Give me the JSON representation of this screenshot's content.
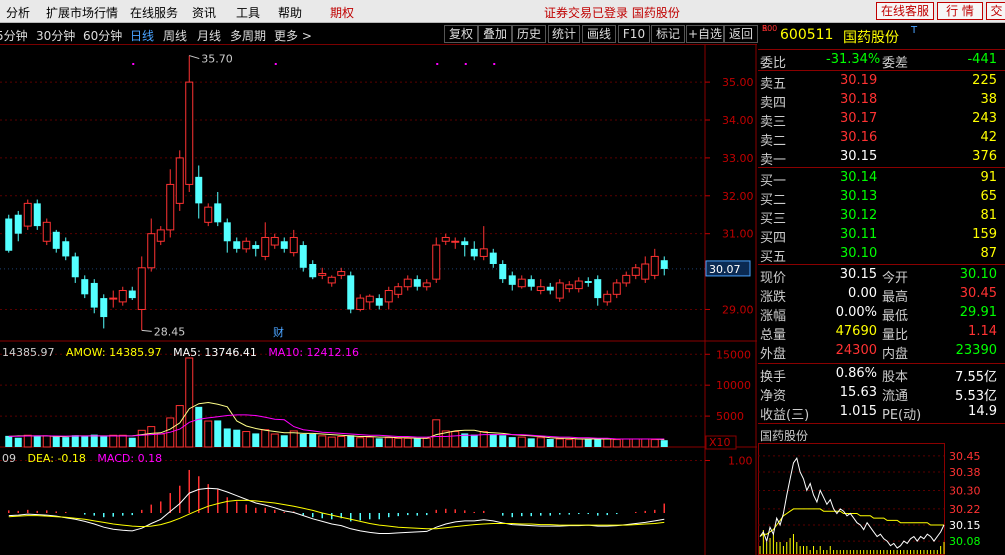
{
  "menu": {
    "items": [
      "分析",
      "扩展市场行情",
      "在线服务",
      "资讯",
      "工具",
      "帮助"
    ],
    "futures": "期权",
    "status": "证券交易已登录  国药股份",
    "right_buttons": [
      "在线客服",
      "行 情",
      "交"
    ]
  },
  "toolbar": {
    "periods": [
      "5分钟",
      "30分钟",
      "60分钟",
      "日线",
      "周线",
      "月线",
      "多周期",
      "更多"
    ],
    "active_period": "日线",
    "buttons": [
      "复权",
      "叠加",
      "历史",
      "统计",
      "画线",
      "F10",
      "标记",
      "+自选",
      "返回"
    ]
  },
  "chart_data": [
    {
      "type": "candlestick",
      "title": "",
      "ylim": [
        28.3,
        35.9
      ],
      "y_ticks": [
        "35.00",
        "34.00",
        "33.00",
        "32.00",
        "31.00",
        "29.00"
      ],
      "current_price_label": "30.07",
      "high_annotation": "35.70",
      "low_annotation": "28.45",
      "event_marker": "财",
      "candles": [
        [
          31.4,
          30.55,
          31.5,
          30.5
        ],
        [
          31.5,
          31.0,
          31.6,
          30.8
        ],
        [
          31.2,
          31.8,
          31.9,
          31.1
        ],
        [
          31.8,
          31.2,
          31.9,
          31.1
        ],
        [
          30.8,
          31.3,
          31.4,
          30.7
        ],
        [
          31.05,
          30.6,
          31.1,
          30.5
        ],
        [
          30.8,
          30.4,
          30.9,
          30.3
        ],
        [
          30.4,
          29.85,
          30.5,
          29.7
        ],
        [
          29.8,
          29.4,
          29.9,
          29.3
        ],
        [
          29.7,
          29.05,
          29.8,
          28.9
        ],
        [
          29.3,
          28.8,
          29.4,
          28.5
        ],
        [
          29.3,
          29.3,
          29.5,
          29.05
        ],
        [
          29.2,
          29.5,
          29.6,
          29.1
        ],
        [
          29.5,
          29.3,
          29.6,
          29.25
        ],
        [
          29.0,
          30.1,
          30.4,
          28.45
        ],
        [
          30.1,
          31.0,
          31.4,
          30.0
        ],
        [
          30.8,
          31.1,
          31.2,
          30.7
        ],
        [
          31.1,
          32.3,
          32.7,
          30.9
        ],
        [
          31.8,
          33.0,
          33.2,
          31.6
        ],
        [
          32.3,
          35.0,
          35.7,
          32.1
        ],
        [
          32.5,
          31.8,
          32.8,
          31.4
        ],
        [
          31.3,
          31.7,
          31.8,
          31.2
        ],
        [
          31.8,
          31.3,
          32.1,
          31.2
        ],
        [
          31.3,
          30.8,
          31.4,
          30.5
        ],
        [
          30.8,
          30.6,
          30.9,
          30.5
        ],
        [
          30.6,
          30.8,
          30.9,
          30.5
        ],
        [
          30.7,
          30.6,
          30.8,
          30.4
        ],
        [
          30.4,
          30.9,
          31.3,
          30.3
        ],
        [
          30.7,
          30.9,
          31.0,
          30.6
        ],
        [
          30.8,
          30.6,
          30.9,
          30.5
        ],
        [
          30.5,
          30.9,
          31.1,
          30.4
        ],
        [
          30.7,
          30.1,
          30.8,
          30.0
        ],
        [
          30.2,
          29.85,
          30.3,
          29.8
        ],
        [
          29.9,
          29.95,
          30.1,
          29.8
        ],
        [
          29.7,
          29.85,
          29.9,
          29.6
        ],
        [
          29.9,
          30.0,
          30.1,
          29.8
        ],
        [
          29.9,
          29.0,
          30.0,
          28.9
        ],
        [
          29.0,
          29.3,
          29.4,
          28.95
        ],
        [
          29.2,
          29.35,
          29.4,
          29.0
        ],
        [
          29.3,
          29.1,
          29.4,
          29.0
        ],
        [
          29.2,
          29.5,
          29.6,
          29.0
        ],
        [
          29.4,
          29.6,
          29.7,
          29.3
        ],
        [
          29.6,
          29.8,
          29.9,
          29.5
        ],
        [
          29.8,
          29.6,
          29.9,
          29.5
        ],
        [
          29.6,
          29.7,
          29.8,
          29.5
        ],
        [
          29.8,
          30.7,
          30.9,
          29.7
        ],
        [
          30.8,
          30.9,
          31.0,
          30.7
        ],
        [
          30.8,
          30.8,
          30.9,
          30.6
        ],
        [
          30.8,
          30.7,
          30.9,
          30.4
        ],
        [
          30.6,
          30.4,
          30.8,
          30.3
        ],
        [
          30.4,
          30.6,
          31.2,
          30.3
        ],
        [
          30.5,
          30.2,
          30.6,
          30.1
        ],
        [
          30.2,
          29.8,
          30.3,
          29.7
        ],
        [
          29.9,
          29.65,
          30.0,
          29.5
        ],
        [
          29.6,
          29.8,
          29.9,
          29.55
        ],
        [
          29.8,
          29.6,
          29.9,
          29.5
        ],
        [
          29.5,
          29.6,
          29.8,
          29.4
        ],
        [
          29.6,
          29.5,
          29.7,
          29.4
        ],
        [
          29.3,
          29.7,
          29.8,
          29.2
        ],
        [
          29.55,
          29.65,
          29.75,
          29.45
        ],
        [
          29.55,
          29.75,
          29.85,
          29.45
        ],
        [
          29.75,
          29.7,
          29.85,
          29.6
        ],
        [
          29.8,
          29.3,
          29.9,
          29.1
        ],
        [
          29.2,
          29.4,
          29.5,
          29.1
        ],
        [
          29.4,
          29.7,
          29.8,
          29.3
        ],
        [
          29.7,
          29.9,
          30.0,
          29.6
        ],
        [
          29.9,
          30.1,
          30.2,
          29.8
        ],
        [
          29.8,
          30.2,
          30.4,
          29.7
        ],
        [
          29.9,
          30.4,
          30.6,
          29.8
        ],
        [
          30.3,
          30.07,
          30.4,
          29.9
        ]
      ]
    },
    {
      "type": "bar",
      "title": "",
      "legend": [
        "14385.97",
        "AMOW: 14385.97",
        "MA5: 13746.41",
        "MA10: 12412.16"
      ],
      "legend_colors": [
        "#d0d0d0",
        "#ffff00",
        "#ffffff",
        "#ff00ff"
      ],
      "y_ticks": [
        "15000",
        "10000",
        "5000"
      ],
      "scale_label": "X10",
      "ylim": [
        0,
        16500
      ],
      "values": [
        1800,
        1500,
        1900,
        1800,
        1800,
        1700,
        1600,
        1900,
        1800,
        2000,
        1700,
        1900,
        1900,
        1500,
        2700,
        3300,
        2100,
        4700,
        6700,
        14400,
        6500,
        4200,
        4300,
        3000,
        2800,
        2500,
        2200,
        2800,
        2100,
        1900,
        2600,
        2100,
        2100,
        1800,
        1600,
        1700,
        1900,
        1500,
        1600,
        1400,
        1500,
        1400,
        1400,
        1400,
        1400,
        4400,
        2600,
        2500,
        2200,
        2000,
        2500,
        2100,
        1900,
        1600,
        1600,
        1400,
        1500,
        1300,
        1300,
        1200,
        1300,
        1300,
        1400,
        1300,
        1200,
        1300,
        1300,
        1300,
        1200,
        1100
      ],
      "ma5": [
        1700,
        1800,
        1800,
        1800,
        1800,
        1700,
        1700,
        1800,
        1800,
        1800,
        1800,
        1800,
        1800,
        1800,
        2000,
        2200,
        2300,
        2900,
        3900,
        6200,
        7000,
        7200,
        6900,
        6500,
        4200,
        3400,
        3000,
        2700,
        2500,
        2300,
        2300,
        2200,
        2200,
        2100,
        2000,
        1900,
        1800,
        1700,
        1700,
        1600,
        1600,
        1500,
        1500,
        1400,
        1400,
        2000,
        2300,
        2600,
        2700,
        2700,
        2400,
        2300,
        2200,
        2000,
        1900,
        1800,
        1700,
        1500,
        1400,
        1400,
        1300,
        1300,
        1300,
        1300,
        1300,
        1300,
        1300,
        1300,
        1300,
        1200
      ],
      "ma10": [
        1750,
        1750,
        1780,
        1800,
        1800,
        1780,
        1760,
        1780,
        1780,
        1790,
        1780,
        1780,
        1780,
        1800,
        1900,
        2000,
        2100,
        2400,
        2900,
        4000,
        4500,
        4700,
        4900,
        5100,
        5200,
        5200,
        5100,
        4800,
        4500,
        4400,
        3300,
        2800,
        2600,
        2400,
        2300,
        2200,
        2100,
        2000,
        1900,
        1900,
        1800,
        1700,
        1700,
        1600,
        1600,
        1700,
        1700,
        1800,
        1900,
        1900,
        2000,
        2000,
        2000,
        2000,
        2000,
        1900,
        1800,
        1700,
        1600,
        1600,
        1500,
        1500,
        1400,
        1400,
        1300,
        1300,
        1300,
        1300,
        1300,
        1300
      ]
    },
    {
      "type": "macd",
      "title": "",
      "legend": [
        "09",
        "DEA: -0.18",
        "MACD: 0.18"
      ],
      "legend_colors": [
        "#d0d0d0",
        "#ffff00",
        "#ff00ff"
      ],
      "y_ticks": [
        "1.00"
      ],
      "ylim": [
        -0.8,
        1.2
      ],
      "macd": [
        0.05,
        0.04,
        0.06,
        0.04,
        0.05,
        0.03,
        0.02,
        0.0,
        -0.03,
        -0.05,
        -0.08,
        -0.07,
        -0.05,
        -0.04,
        0.06,
        0.16,
        0.22,
        0.38,
        0.52,
        0.82,
        0.7,
        0.55,
        0.45,
        0.3,
        0.22,
        0.16,
        0.1,
        0.1,
        0.06,
        0.02,
        0.03,
        -0.04,
        -0.08,
        -0.1,
        -0.12,
        -0.1,
        -0.16,
        -0.14,
        -0.12,
        -0.12,
        -0.08,
        -0.06,
        -0.04,
        -0.05,
        -0.04,
        0.06,
        0.08,
        0.07,
        0.05,
        0.02,
        0.04,
        0.0,
        -0.05,
        -0.08,
        -0.06,
        -0.06,
        -0.05,
        -0.05,
        -0.03,
        -0.03,
        -0.02,
        -0.02,
        -0.05,
        -0.04,
        -0.02,
        0.0,
        0.02,
        0.04,
        0.06,
        0.18
      ],
      "dif": [
        -0.05,
        -0.04,
        -0.02,
        -0.03,
        -0.04,
        -0.06,
        -0.09,
        -0.12,
        -0.16,
        -0.21,
        -0.27,
        -0.31,
        -0.33,
        -0.34,
        -0.29,
        -0.2,
        -0.12,
        0.03,
        0.18,
        0.38,
        0.45,
        0.47,
        0.46,
        0.4,
        0.33,
        0.26,
        0.19,
        0.15,
        0.1,
        0.04,
        0.01,
        -0.05,
        -0.11,
        -0.16,
        -0.21,
        -0.24,
        -0.3,
        -0.34,
        -0.37,
        -0.39,
        -0.39,
        -0.38,
        -0.37,
        -0.36,
        -0.35,
        -0.27,
        -0.21,
        -0.17,
        -0.15,
        -0.15,
        -0.13,
        -0.15,
        -0.19,
        -0.22,
        -0.23,
        -0.24,
        -0.25,
        -0.25,
        -0.25,
        -0.24,
        -0.24,
        -0.23,
        -0.25,
        -0.25,
        -0.24,
        -0.22,
        -0.2,
        -0.18,
        -0.15,
        -0.12
      ],
      "dea": [
        -0.07,
        -0.06,
        -0.05,
        -0.05,
        -0.06,
        -0.07,
        -0.08,
        -0.1,
        -0.12,
        -0.15,
        -0.18,
        -0.21,
        -0.23,
        -0.25,
        -0.26,
        -0.25,
        -0.22,
        -0.17,
        -0.1,
        -0.02,
        0.06,
        0.13,
        0.18,
        0.22,
        0.24,
        0.24,
        0.23,
        0.21,
        0.19,
        0.16,
        0.13,
        0.09,
        0.05,
        0.0,
        -0.04,
        -0.08,
        -0.12,
        -0.16,
        -0.2,
        -0.23,
        -0.25,
        -0.27,
        -0.28,
        -0.29,
        -0.3,
        -0.3,
        -0.28,
        -0.26,
        -0.24,
        -0.22,
        -0.21,
        -0.2,
        -0.2,
        -0.2,
        -0.21,
        -0.21,
        -0.22,
        -0.22,
        -0.23,
        -0.23,
        -0.23,
        -0.23,
        -0.23,
        -0.23,
        -0.23,
        -0.23,
        -0.22,
        -0.21,
        -0.2,
        -0.18
      ]
    },
    {
      "type": "line",
      "title": "国药股份",
      "y_ticks": [
        "30.45",
        "30.38",
        "30.30",
        "30.22",
        "30.15",
        "30.08"
      ],
      "ylim": [
        30.05,
        30.48
      ],
      "price": [
        30.1,
        30.12,
        30.08,
        30.14,
        30.11,
        30.18,
        30.15,
        30.2,
        30.28,
        30.35,
        30.42,
        30.44,
        30.38,
        30.35,
        30.3,
        30.33,
        30.28,
        30.25,
        30.3,
        30.27,
        30.24,
        30.26,
        30.22,
        30.2,
        30.22,
        30.21,
        30.19,
        30.2,
        30.18,
        30.16,
        30.15,
        30.13,
        30.16,
        30.14,
        30.12,
        30.1,
        30.11,
        30.09,
        30.08,
        30.06,
        30.07,
        30.05,
        30.06,
        30.08,
        30.07,
        30.09,
        30.1,
        30.08,
        30.1,
        30.09,
        30.11,
        30.1,
        30.08,
        30.1,
        30.12,
        30.15
      ],
      "avg": [
        30.1,
        30.11,
        30.11,
        30.12,
        30.13,
        30.15,
        30.17,
        30.19,
        30.2,
        30.21,
        30.22,
        30.22,
        30.22,
        30.22,
        30.22,
        30.22,
        30.22,
        30.22,
        30.22,
        30.21,
        30.21,
        30.21,
        30.21,
        30.21,
        30.21,
        30.2,
        30.2,
        30.2,
        30.2,
        30.2,
        30.19,
        30.19,
        30.19,
        30.19,
        30.18,
        30.18,
        30.18,
        30.18,
        30.17,
        30.17,
        30.17,
        30.17,
        30.16,
        30.16,
        30.16,
        30.16,
        30.16,
        30.16,
        30.16,
        30.16,
        30.16,
        30.15,
        30.15,
        30.15,
        30.15,
        30.15
      ],
      "volume": [
        2,
        6,
        3,
        4,
        5,
        3,
        3,
        2,
        3,
        4,
        5,
        3,
        2,
        2,
        2,
        1,
        2,
        1,
        2,
        1,
        1,
        2,
        1,
        1,
        1,
        1,
        1,
        1,
        1,
        1,
        1,
        1,
        1,
        1,
        1,
        1,
        1,
        1,
        1,
        1,
        1,
        1,
        1,
        1,
        1,
        1,
        1,
        1,
        1,
        1,
        1,
        1,
        1,
        1,
        2,
        3
      ]
    }
  ],
  "quote": {
    "code": "600511",
    "name": "国药股份",
    "badge_top": "R",
    "badge_bottom": "500",
    "t_mark": "T",
    "weibi_label": "委比",
    "weibi": "-31.34%",
    "weicha_label": "委差",
    "weicha": "-441",
    "asks": [
      {
        "label": "卖五",
        "price": "30.19",
        "vol": "225"
      },
      {
        "label": "卖四",
        "price": "30.18",
        "vol": "38"
      },
      {
        "label": "卖三",
        "price": "30.17",
        "vol": "243"
      },
      {
        "label": "卖二",
        "price": "30.16",
        "vol": "42"
      },
      {
        "label": "卖一",
        "price": "30.15",
        "vol": "376"
      }
    ],
    "bids": [
      {
        "label": "买一",
        "price": "30.14",
        "vol": "91"
      },
      {
        "label": "买二",
        "price": "30.13",
        "vol": "65"
      },
      {
        "label": "买三",
        "price": "30.12",
        "vol": "81"
      },
      {
        "label": "买四",
        "price": "30.11",
        "vol": "159"
      },
      {
        "label": "买五",
        "price": "30.10",
        "vol": "87"
      }
    ],
    "stats": [
      {
        "l1": "现价",
        "v1": "30.15",
        "l2": "今开",
        "v2": "30.10"
      },
      {
        "l1": "涨跌",
        "v1": "0.00",
        "l2": "最高",
        "v2": "30.45"
      },
      {
        "l1": "涨幅",
        "v1": "0.00%",
        "l2": "最低",
        "v2": "29.91"
      },
      {
        "l1": "总量",
        "v1": "47690",
        "l2": "量比",
        "v2": "1.14"
      },
      {
        "l1": "外盘",
        "v1": "24300",
        "l2": "内盘",
        "v2": "23390"
      }
    ],
    "fin": [
      {
        "l1": "换手",
        "v1": "0.86%",
        "l2": "股本",
        "v2": "7.55亿"
      },
      {
        "l1": "净资",
        "v1": "15.63",
        "l2": "流通",
        "v2": "5.53亿"
      },
      {
        "l1": "收益(三)",
        "v1": "1.015",
        "l2": "PE(动)",
        "v2": "14.9"
      }
    ]
  },
  "colors": {
    "up": "#ff3232",
    "down": "#54ffff",
    "ma5": "#ffffff",
    "ma10": "#ff00ff",
    "dif": "#ffffff",
    "dea": "#ffff00",
    "axis": "#c00000"
  }
}
